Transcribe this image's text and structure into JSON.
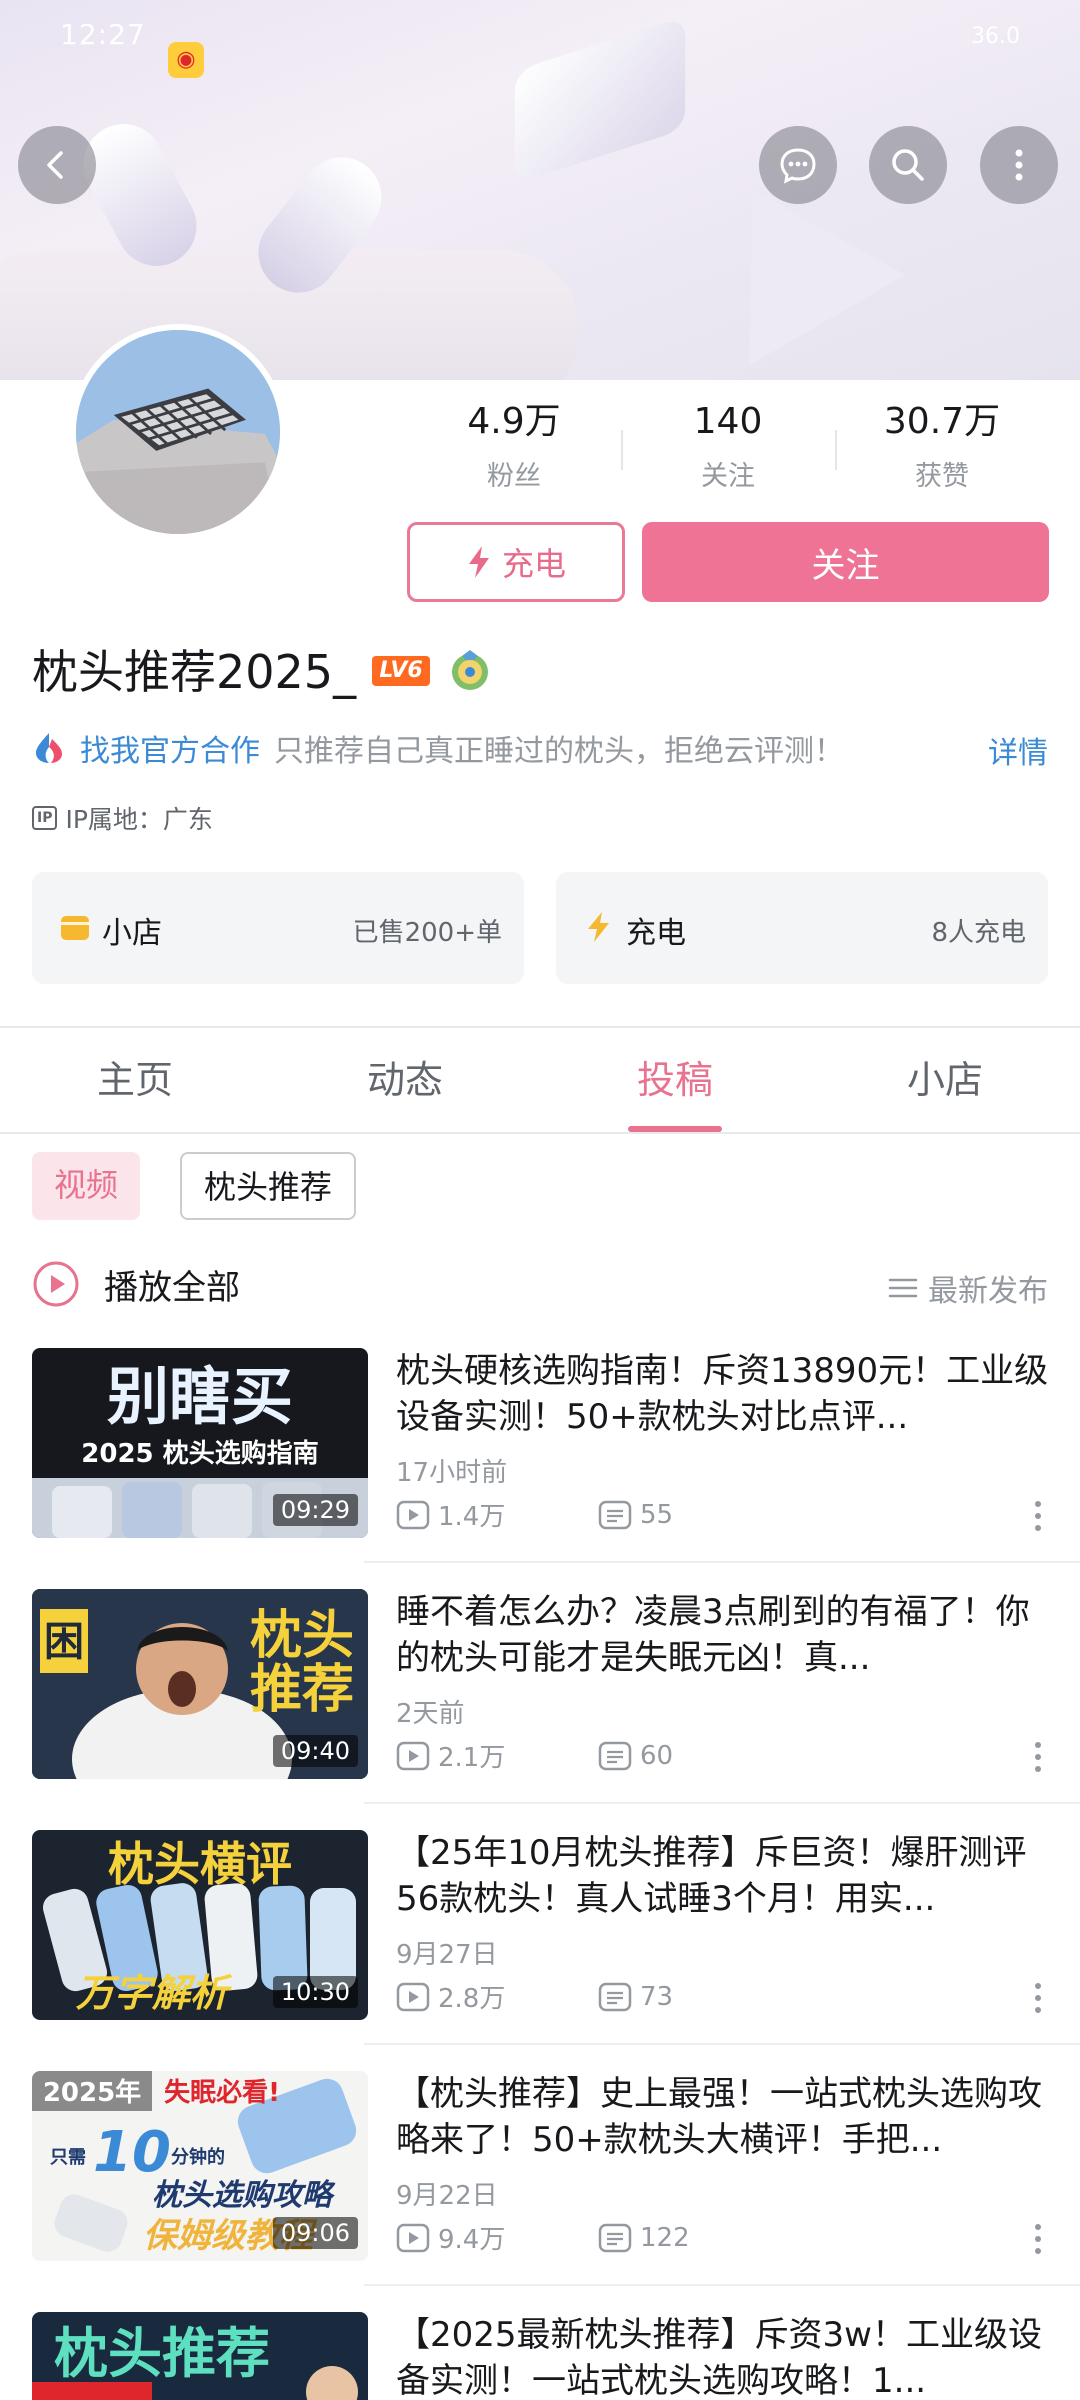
{
  "status_bar": {
    "time": "12:27",
    "right": "36.0"
  },
  "header": {
    "back_icon": "back-arrow-icon",
    "message_icon": "chat-bubble-icon",
    "search_icon": "search-icon",
    "more_icon": "more-vertical-icon"
  },
  "profile": {
    "stats": [
      {
        "value": "4.9万",
        "label": "粉丝"
      },
      {
        "value": "140",
        "label": "关注"
      },
      {
        "value": "30.7万",
        "label": "获赞"
      }
    ],
    "charge_button": "充电",
    "follow_button": "关注",
    "username": "枕头推荐2025_",
    "level": "LV6",
    "coop_link": "找我官方合作",
    "signature": "只推荐自己真正睡过的枕头，拒绝云评测！",
    "detail": "详情",
    "ip_tag": "IP",
    "ip_location": "IP属地：广东"
  },
  "cards": {
    "shop": {
      "title": "小店",
      "value": "已售200+单"
    },
    "charge": {
      "title": "充电",
      "value": "8人充电"
    }
  },
  "tabs": [
    "主页",
    "动态",
    "投稿",
    "小店"
  ],
  "active_tab": "投稿",
  "filters": [
    "视频",
    "枕头推荐"
  ],
  "play_all": "播放全部",
  "sort": "最新发布",
  "videos": [
    {
      "title": "枕头硬核选购指南！斥资13890元！工业级设备实测！50+款枕头对比点评...",
      "time": "17小时前",
      "views": "1.4万",
      "comments": "55",
      "duration": "09:29",
      "thumb_text": [
        "别瞎买",
        "2025 枕头选购指南"
      ]
    },
    {
      "title": "睡不着怎么办？凌晨3点刷到的有福了！你的枕头可能才是失眠元凶！真...",
      "time": "2天前",
      "views": "2.1万",
      "comments": "60",
      "duration": "09:40",
      "thumb_text": [
        "困",
        "枕头",
        "推荐"
      ]
    },
    {
      "title": "【25年10月枕头推荐】斥巨资！爆肝测评56款枕头！真人试睡3个月！用实...",
      "time": "9月27日",
      "views": "2.8万",
      "comments": "73",
      "duration": "10:30",
      "thumb_text": [
        "枕头横评",
        "万字解析"
      ]
    },
    {
      "title": "【枕头推荐】史上最强！一站式枕头选购攻略来了！50+款枕头大横评！手把...",
      "time": "9月22日",
      "views": "9.4万",
      "comments": "122",
      "duration": "09:06",
      "thumb_text": [
        "2025年",
        "失眠必看!",
        "只需",
        "10",
        "分钟的",
        "枕头选购攻略",
        "保姆级教程"
      ]
    },
    {
      "title": "【2025最新枕头推荐】斥资3w！工业级设备实测！一站式枕头选购攻略！1...",
      "thumb_text": [
        "枕头推荐"
      ]
    }
  ],
  "colors": {
    "accent": "#ef7394",
    "link": "#3b8ad6",
    "muted": "#9499a0"
  }
}
